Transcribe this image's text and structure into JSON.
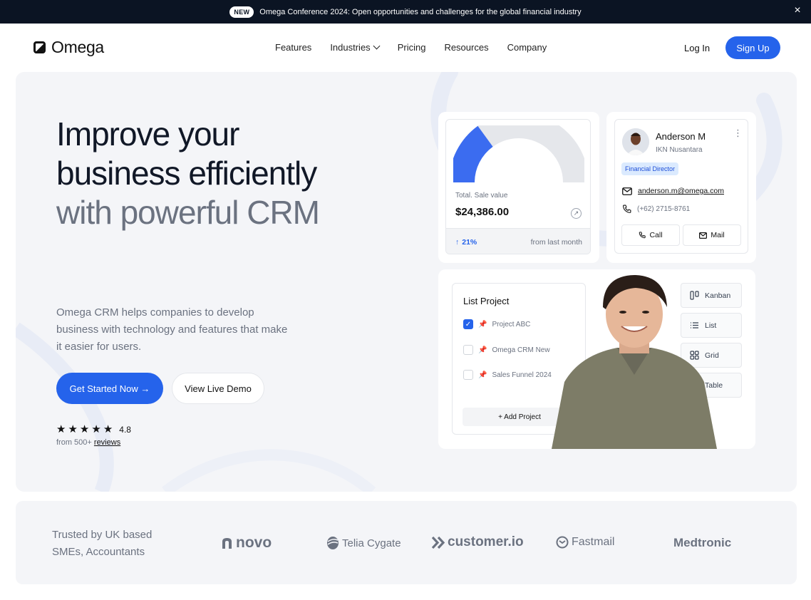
{
  "announcement": {
    "badge": "NEW",
    "text": "Omega Conference 2024: Open opportunities and challenges for the global financial industry"
  },
  "header": {
    "brand": "Omega",
    "nav": [
      "Features",
      "Industries",
      "Pricing",
      "Resources",
      "Company"
    ],
    "login": "Log In",
    "signup": "Sign Up"
  },
  "hero": {
    "title_line1": "Improve your",
    "title_line2": "business efficiently",
    "title_line3": "with powerful CRM",
    "lead": "Omega CRM helps companies to develop business with technology and features that make it easier for users.",
    "cta_primary": "Get Started Now →",
    "cta_secondary": "View Live Demo",
    "rating": "4.8",
    "rating_stars": 5,
    "reviews_prefix": "from 500+",
    "reviews_link": "reviews"
  },
  "sales_card": {
    "label": "Total. Sale value",
    "value": "$24,386.00",
    "growth": "21%",
    "growth_note": "from last month",
    "gauge_fraction": 0.3
  },
  "contact_card": {
    "name": "Anderson M",
    "org": "IKN Nusantara",
    "role": "Financial Director",
    "email": "anderson.m@omega.com",
    "phone": "(+62) 2715-8761",
    "call": "Call",
    "mail": "Mail"
  },
  "project_card": {
    "title": "List Project",
    "items": [
      {
        "name": "Project ABC",
        "checked": true
      },
      {
        "name": "Omega CRM New",
        "checked": false
      },
      {
        "name": "Sales Funnel 2024",
        "checked": false
      }
    ],
    "add": "+ Add Project",
    "views": [
      "Kanban",
      "List",
      "Grid",
      "Table"
    ]
  },
  "trusted": {
    "text": "Trusted by UK based SMEs, Accountants",
    "brands": [
      "novo",
      "Telia Cygate",
      "customer.io",
      "Fastmail",
      "Medtronic"
    ]
  },
  "colors": {
    "accent": "#2563eb",
    "topbar": "#0b1423",
    "hero_bg": "#f4f5f8"
  }
}
